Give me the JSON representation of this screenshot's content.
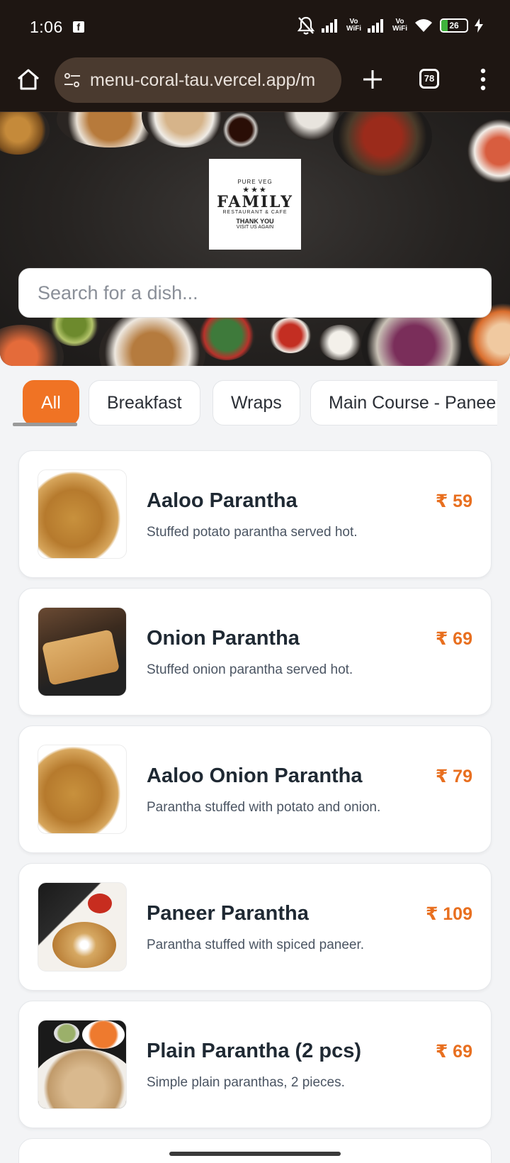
{
  "status_bar": {
    "time": "1:06",
    "vowifi_label": "Vo\nWiFi",
    "battery_level": "26",
    "battery_fraction": 0.26
  },
  "browser": {
    "url": "menu-coral-tau.vercel.app/m",
    "tab_count": "78"
  },
  "hero": {
    "logo": {
      "top_text": "PURE VEG",
      "stars": "★★★",
      "name": "FAMILY",
      "subtitle": "RESTAURANT & CAFE",
      "thanks": "THANK YOU",
      "visit": "VISIT US AGAIN"
    },
    "search_placeholder": "Search for a dish..."
  },
  "categories": [
    {
      "label": "All",
      "active": true
    },
    {
      "label": "Breakfast",
      "active": false
    },
    {
      "label": "Wraps",
      "active": false
    },
    {
      "label": "Main Course - Paneer",
      "active": false
    }
  ],
  "colors": {
    "accent": "#f07324",
    "price": "#e86f1f",
    "topbar": "#1e1612"
  },
  "dishes": [
    {
      "name": "Aaloo Parantha",
      "description": "Stuffed potato parantha served hot.",
      "price": "₹ 59"
    },
    {
      "name": "Onion Parantha",
      "description": "Stuffed onion parantha served hot.",
      "price": "₹ 69"
    },
    {
      "name": "Aaloo Onion Parantha",
      "description": "Parantha stuffed with potato and onion.",
      "price": "₹ 79"
    },
    {
      "name": "Paneer Parantha",
      "description": "Parantha stuffed with spiced paneer.",
      "price": "₹ 109"
    },
    {
      "name": "Plain Parantha (2 pcs)",
      "description": "Simple plain paranthas, 2 pieces.",
      "price": "₹ 69"
    }
  ]
}
